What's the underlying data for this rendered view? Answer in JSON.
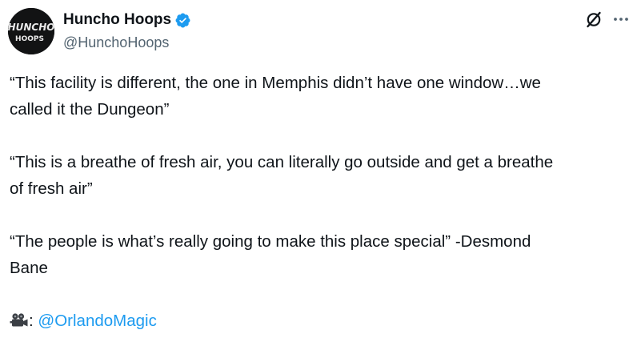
{
  "author": {
    "display_name": "Huncho Hoops",
    "handle": "@HunchoHoops",
    "avatar_text_line1": "HUNCHO",
    "avatar_text_line2": "HOOPS",
    "verified": true
  },
  "tweet": {
    "paragraph1_line1": "“This facility is different, the one in Memphis didn’t have one window…we",
    "paragraph1_line2": "called it the Dungeon”",
    "paragraph2_line1": "“This is a breathe of fresh air, you can literally go outside and get a breathe",
    "paragraph2_line2": "of fresh air”",
    "paragraph3_line1": "“The people is what’s really going to make this place special” -Desmond",
    "paragraph3_line2": "Bane",
    "credit_separator": ": ",
    "credit_mention": "@OrlandoMagic",
    "credit_icon": "movie-camera-icon"
  },
  "icons": {
    "verified": "verified-badge-icon",
    "grok": "grok-icon",
    "more": "more-options-icon"
  },
  "colors": {
    "link": "#1d9bf0",
    "text": "#0f1419",
    "secondary_text": "#536471",
    "verified_badge": "#1d9bf0"
  }
}
